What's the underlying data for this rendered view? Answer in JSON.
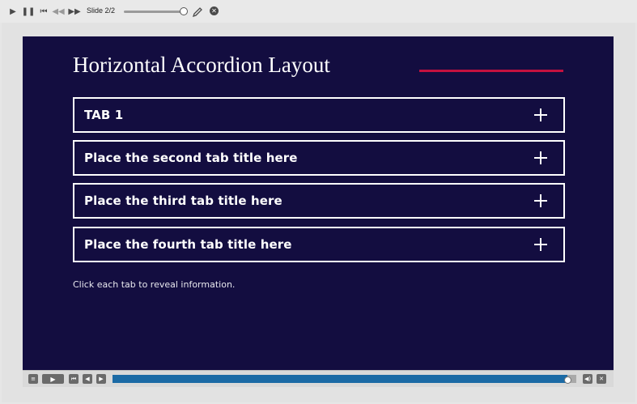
{
  "toolbar": {
    "slide_label": "Slide 2/2",
    "icons": [
      "play-icon",
      "pause-icon",
      "skip-back-icon",
      "rewind-icon",
      "fast-forward-icon",
      "pencil-icon",
      "close-icon"
    ]
  },
  "slide": {
    "title": "Horizontal Accordion Layout",
    "accent_color": "#c4113f",
    "background_color": "#130d40",
    "tabs": [
      {
        "label": "TAB 1"
      },
      {
        "label": "Place the second tab title here"
      },
      {
        "label": "Place the third tab title here"
      },
      {
        "label": "Place the fourth tab title here"
      }
    ],
    "instruction": "Click each tab to reveal information."
  },
  "player": {
    "progress": 0.98,
    "progress_color": "#1b6aa5"
  }
}
